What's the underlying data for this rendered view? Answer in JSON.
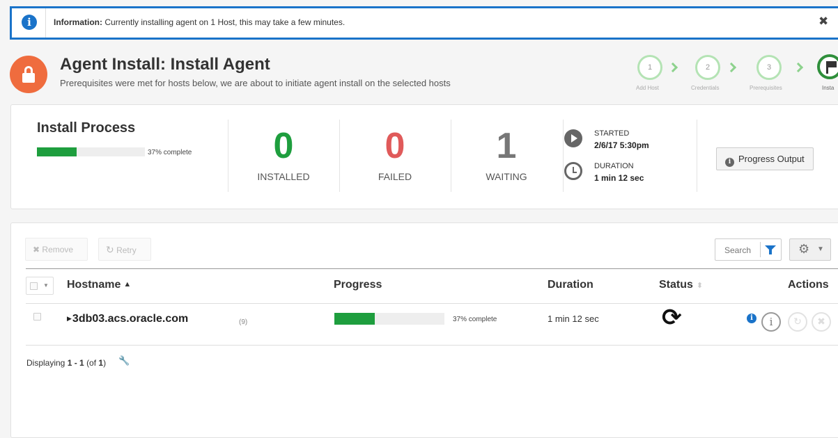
{
  "banner": {
    "prefix": "Information:",
    "message": "Currently installing agent on 1 Host, this may take a few minutes.",
    "close_glyph": "✖"
  },
  "header": {
    "title": "Agent Install: Install Agent",
    "subtitle": "Prerequisites were met for hosts below, we are about to initiate agent install on the selected hosts",
    "icon": "lock-icon"
  },
  "train": {
    "steps": [
      {
        "number": "1",
        "label": "Add Host"
      },
      {
        "number": "2",
        "label": "Credentials"
      },
      {
        "number": "3",
        "label": "Prerequisites"
      },
      {
        "number": "",
        "label": "Insta"
      }
    ],
    "active_color": "#2f8f3b",
    "inactive_color": "#b4e3b4"
  },
  "install_process": {
    "title": "Install Process",
    "progress_fraction": 0.37,
    "progress_text": "37% complete",
    "installed": {
      "value": "0",
      "label": "INSTALLED",
      "color": "#1e9e3e"
    },
    "failed": {
      "value": "0",
      "label": "FAILED",
      "color": "#e05a5a"
    },
    "waiting": {
      "value": "1",
      "label": "WAITING",
      "color": "#777777"
    },
    "started_label": "STARTED",
    "started_value": "2/6/17 5:30pm",
    "duration_label": "DURATION",
    "duration_value": "1 min 12 sec",
    "progress_output_label": "Progress Output"
  },
  "toolbar": {
    "remove_label": "Remove",
    "retry_label": "Retry",
    "search_placeholder": "Search",
    "settings_icon": "gear-icon"
  },
  "table": {
    "columns": {
      "hostname": "Hostname",
      "progress": "Progress",
      "duration": "Duration",
      "status": "Status",
      "actions": "Actions"
    },
    "rows": [
      {
        "hostname": "3db03.acs.oracle.com",
        "count": "(9)",
        "progress_fraction": 0.37,
        "progress_text": "37% complete",
        "duration": "1 min 12 sec",
        "status_icon": "sync-icon"
      }
    ]
  },
  "footer": {
    "prefix": "Displaying",
    "range": "1 - 1",
    "of_open": "(of",
    "total": "1",
    "of_close": ")"
  },
  "colors": {
    "accent": "#1a73c9",
    "progress_fill": "#1e9e3e",
    "lock_bg": "#ef6c3e"
  }
}
